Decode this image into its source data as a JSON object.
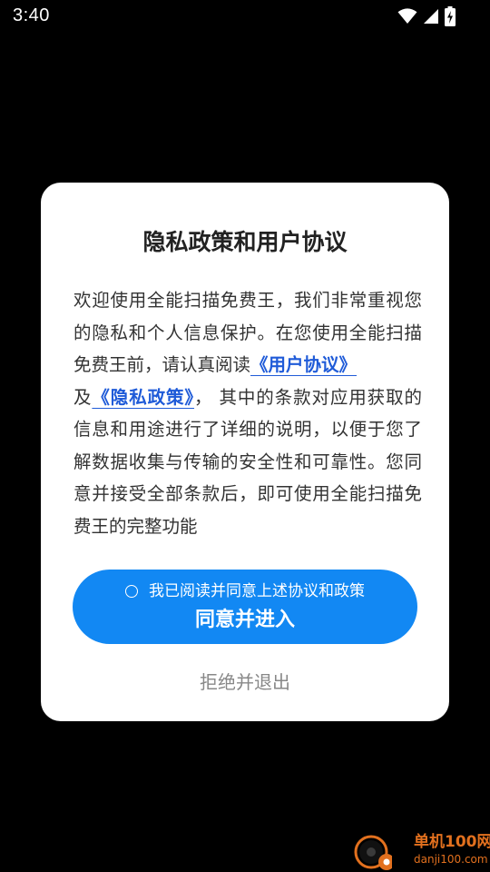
{
  "status_bar": {
    "time": "3:40",
    "icons": [
      "wifi-icon",
      "cellular-signal-icon",
      "battery-charging-icon"
    ]
  },
  "dialog": {
    "title": "隐私政策和用户协议",
    "body": {
      "intro": "欢迎使用全能扫描免费王，我们非常重视您的隐私和个人信息保护。在您使用全能扫描免费王前，请认真阅读",
      "user_agreement_link": "《用户协议》",
      "conjunction": "及",
      "privacy_policy_link": "《隐私政策》",
      "rest": "， 其中的条款对应用获取的信息和用途进行了详细的说明，以便于您了解数据收集与传输的安全性和可靠性。您同意并接受全部条款后，即可使用全能扫描免费王的完整功能"
    },
    "agree_checkbox_label": "我已阅读并同意上述协议和政策",
    "agree_checkbox_checked": false,
    "agree_button_label": "同意并进入",
    "reject_button_label": "拒绝并退出"
  },
  "watermark": {
    "name": "单机100网",
    "domain": "danji100.com"
  },
  "colors": {
    "background": "#000000",
    "dialog_background": "#ffffff",
    "primary_button": "#1288f3",
    "link": "#1f5bd8",
    "reject_text": "#888888",
    "watermark": "#e2701e"
  }
}
